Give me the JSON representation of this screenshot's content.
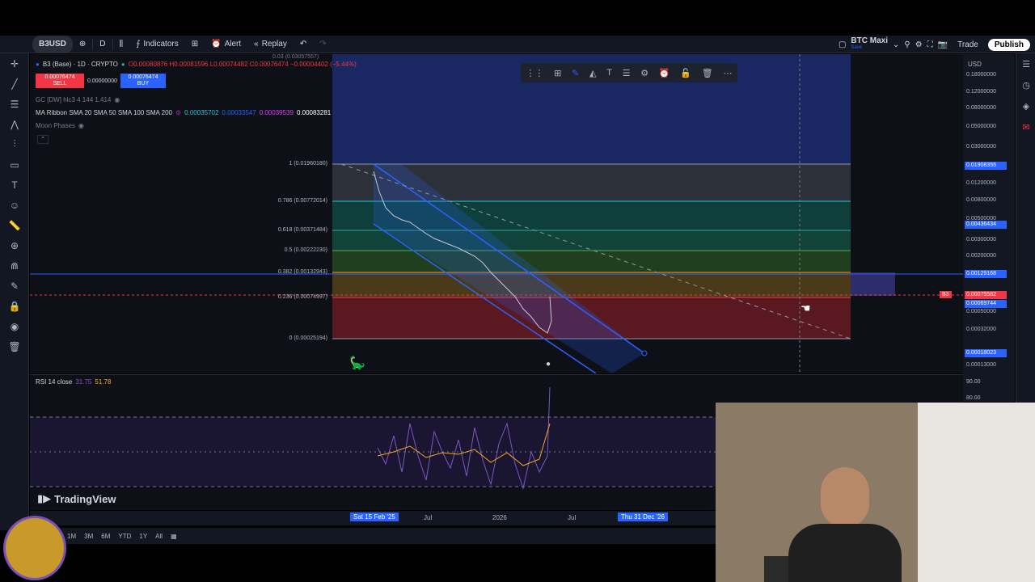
{
  "topbar": {
    "symbol": "B3USD",
    "interval": "D",
    "indicators_label": "Indicators",
    "alert_label": "Alert",
    "replay_label": "Replay",
    "layout_name": "BTC Maxi",
    "layout_sub": "Save",
    "trade_label": "Trade",
    "publish_label": "Publish"
  },
  "legend": {
    "title": "B3 (Base) · 1D · CRYPTO",
    "ohlc": "O0.00080876 H0.00081596 L0.00074482 C0.00076474 −0.00004402 (−5.44%)",
    "sell_price": "0.00076474",
    "sell_label": "SELL",
    "spread": "0.00000000",
    "buy_price": "0.00076474",
    "buy_label": "BUY",
    "gc_line": "GC [DW] hlc3 4 144 1.414",
    "ma_ribbon": "MA Ribbon SMA 20 SMA 50 SMA 100 SMA 200",
    "ma_values": [
      "0.00035702",
      "0.00033547",
      "0.00039539",
      "0.00083281"
    ],
    "moon_phases": "Moon Phases",
    "top_value": "0.03 (0.03057557)"
  },
  "fib_levels": [
    {
      "label": "1 (0.01960180)"
    },
    {
      "label": "0.786 (0.00772014)"
    },
    {
      "label": "0.618 (0.00371484)"
    },
    {
      "label": "0.5 (0.00222230)"
    },
    {
      "label": "0.382 (0.00132943)"
    },
    {
      "label": "0.236 (0.00074997)"
    },
    {
      "label": "0 (0.00025194)"
    }
  ],
  "price_axis": {
    "currency": "USD",
    "ticks": [
      "0.18000000",
      "0.12000000",
      "0.08000000",
      "0.05000000",
      "0.03000000",
      "0.01200000",
      "0.00800000",
      "0.00500000",
      "0.00300000",
      "0.00200000",
      "0.00050000",
      "0.00032000",
      "0.00013000"
    ],
    "tags": [
      {
        "value": "0.01908355",
        "color": "#2962ff"
      },
      {
        "value": "0.00436434",
        "color": "#2962ff"
      },
      {
        "value": "0.00129168",
        "color": "#2962ff"
      },
      {
        "value": "0.00075582",
        "color": "#f23645"
      },
      {
        "value": "0.00069744",
        "color": "#2962ff"
      },
      {
        "value": "0.00018023",
        "color": "#2962ff"
      }
    ],
    "rsi_ticks": [
      "90.00",
      "80.00"
    ]
  },
  "rsi": {
    "label": "RSI 14 close",
    "value1": "31.75",
    "value2": "51.78"
  },
  "time_axis": {
    "start_label": "Sat 15 Feb '25",
    "labels": [
      "Jul",
      "2026",
      "Jul"
    ],
    "end_label": "Thu 31 Dec '26"
  },
  "ranges": [
    "1M",
    "3M",
    "6M",
    "YTD",
    "1Y",
    "All"
  ],
  "brand": "TradingView",
  "chart_label": "B3",
  "colors": {
    "bg": "#0e1018",
    "panel": "#131722",
    "accent": "#2962ff",
    "red": "#f23645",
    "channel": "#2962ff"
  }
}
